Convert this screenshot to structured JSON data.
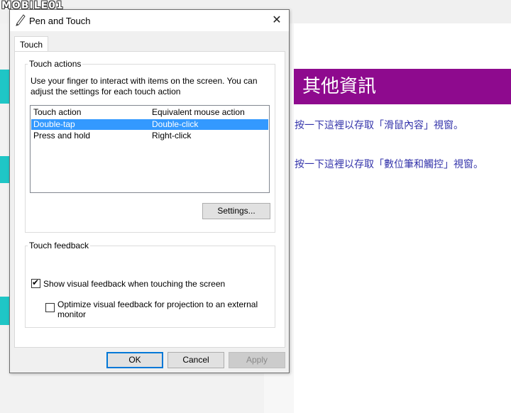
{
  "background": {
    "watermark": "MOBILE01",
    "info_title": "其他資訊",
    "links": [
      "按一下這裡以存取「滑鼠內容」視窗。",
      "按一下這裡以存取「數位筆和觸控」視窗。"
    ],
    "colors": {
      "header": "#8e0a8e",
      "accent": "#1fc6c6",
      "link": "#3333aa"
    }
  },
  "dialog": {
    "title": "Pen and Touch",
    "title_icon": "pen-icon",
    "close_label": "✕",
    "tabs": [
      {
        "label": "Touch"
      }
    ],
    "touch_actions": {
      "legend": "Touch actions",
      "description_line1": "Use your finger to interact with items on the screen. You can",
      "description_line2": "adjust the settings for each touch action",
      "columns": [
        "Touch action",
        "Equivalent mouse action"
      ],
      "rows": [
        {
          "action": "Double-tap",
          "mouse": "Double-click",
          "selected": true
        },
        {
          "action": "Press and hold",
          "mouse": "Right-click",
          "selected": false
        }
      ],
      "settings_label": "Settings..."
    },
    "touch_feedback": {
      "legend": "Touch feedback",
      "show_visual_feedback": {
        "label": "Show visual feedback when touching the screen",
        "checked": true
      },
      "optimize_feedback": {
        "label_line1": "Optimize visual feedback for projection to an external",
        "label_line2": "monitor",
        "checked": false
      }
    },
    "buttons": {
      "ok": "OK",
      "cancel": "Cancel",
      "apply": "Apply"
    }
  }
}
